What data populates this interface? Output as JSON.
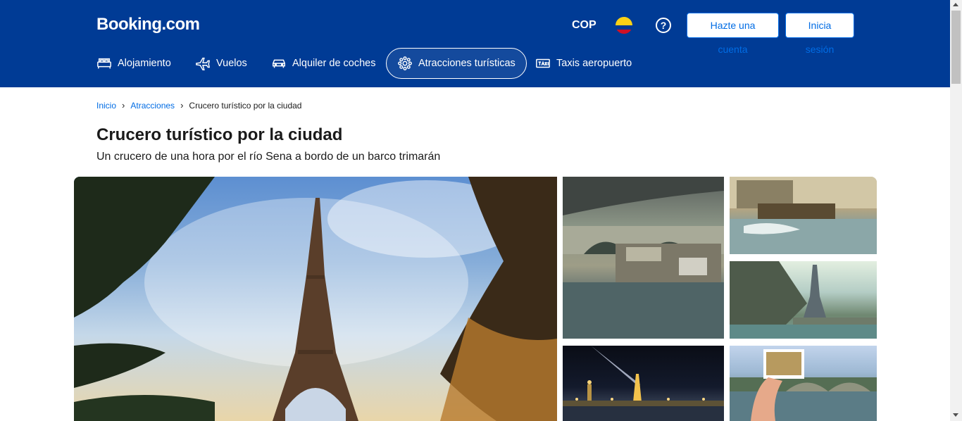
{
  "header": {
    "logo": "Booking.com",
    "currency": "COP",
    "help_icon": "question-circle-icon",
    "register_label": "Hazte una cuenta",
    "signin_label": "Inicia sesión"
  },
  "nav": {
    "items": [
      {
        "label": "Alojamiento",
        "icon": "bed-icon"
      },
      {
        "label": "Vuelos",
        "icon": "plane-icon"
      },
      {
        "label": "Alquiler de coches",
        "icon": "car-icon"
      },
      {
        "label": "Atracciones turísticas",
        "icon": "attractions-icon",
        "active": true
      },
      {
        "label": "Taxis aeropuerto",
        "icon": "taxi-icon"
      }
    ]
  },
  "breadcrumb": {
    "items": [
      "Inicio",
      "Atracciones",
      "Crucero turístico por la ciudad"
    ]
  },
  "page": {
    "title": "Crucero turístico por la ciudad",
    "subtitle": "Un crucero de una hora por el río Sena a bordo de un barco trimarán"
  },
  "colors": {
    "brand_blue": "#003b95",
    "link_blue": "#006ce4"
  }
}
